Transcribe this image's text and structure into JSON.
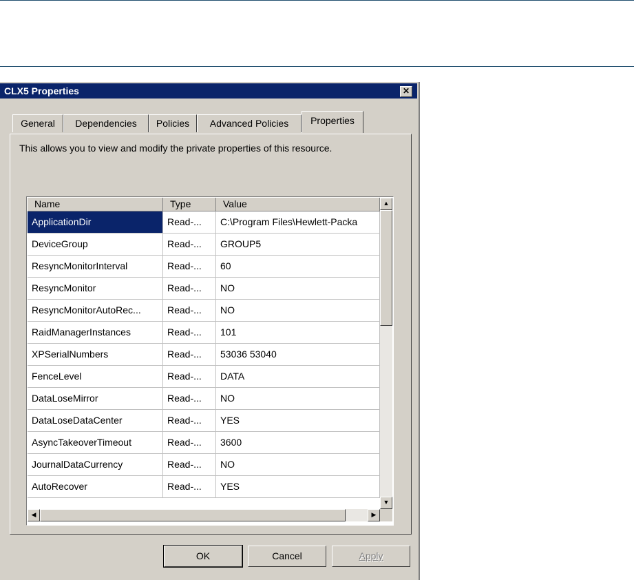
{
  "dialog": {
    "title": "CLX5 Properties",
    "close_glyph": "✕"
  },
  "tabs": [
    {
      "label": "General",
      "active": false
    },
    {
      "label": "Dependencies",
      "active": false
    },
    {
      "label": "Policies",
      "active": false
    },
    {
      "label": "Advanced Policies",
      "active": false
    },
    {
      "label": "Properties",
      "active": true
    }
  ],
  "panel": {
    "description": "This allows you to view and modify the private properties of this resource."
  },
  "list": {
    "columns": [
      "Name",
      "Type",
      "Value"
    ],
    "rows": [
      {
        "name": "ApplicationDir",
        "type": "Read-...",
        "value": "C:\\Program Files\\Hewlett-Packa"
      },
      {
        "name": "DeviceGroup",
        "type": "Read-...",
        "value": "GROUP5"
      },
      {
        "name": "ResyncMonitorInterval",
        "type": "Read-...",
        "value": "60"
      },
      {
        "name": "ResyncMonitor",
        "type": "Read-...",
        "value": "NO"
      },
      {
        "name": "ResyncMonitorAutoRec...",
        "type": "Read-...",
        "value": "NO"
      },
      {
        "name": "RaidManagerInstances",
        "type": "Read-...",
        "value": " 101"
      },
      {
        "name": "XPSerialNumbers",
        "type": "Read-...",
        "value": " 53036 53040"
      },
      {
        "name": "FenceLevel",
        "type": "Read-...",
        "value": "DATA"
      },
      {
        "name": "DataLoseMirror",
        "type": "Read-...",
        "value": "NO"
      },
      {
        "name": "DataLoseDataCenter",
        "type": "Read-...",
        "value": "YES"
      },
      {
        "name": "AsyncTakeoverTimeout",
        "type": "Read-...",
        "value": "3600"
      },
      {
        "name": "JournalDataCurrency",
        "type": "Read-...",
        "value": "NO"
      },
      {
        "name": "AutoRecover",
        "type": "Read-...",
        "value": "YES"
      }
    ],
    "selected_index": 0
  },
  "scroll_icons": {
    "up": "up-arrow-icon",
    "down": "down-arrow-icon",
    "left": "left-arrow-icon",
    "right": "right-arrow-icon"
  },
  "buttons": {
    "ok": "OK",
    "cancel": "Cancel",
    "apply": "Apply"
  },
  "colors": {
    "titlebar": "#0a246a",
    "dialog_face": "#d4d0c8",
    "selection": "#0a246a"
  }
}
